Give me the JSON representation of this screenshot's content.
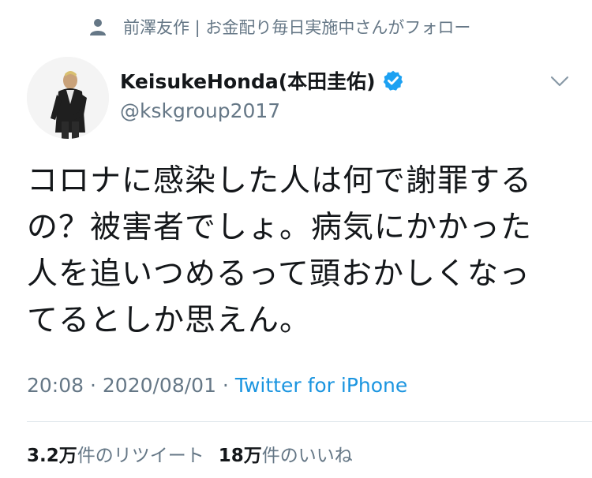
{
  "social_context": {
    "icon": "person-icon",
    "text": "前澤友作 | お金配り毎日実施中さんがフォロー"
  },
  "author": {
    "display_name": "KeisukeHonda(本田圭佑)",
    "handle": "@kskgroup2017",
    "verified": true
  },
  "tweet": {
    "lines": [
      "コロナに感染した人は何で謝罪する",
      "の？被害者でしょ。病気にかかった",
      "人を追いつめるって頭おかしくなっ",
      "てるとしか思えん。"
    ]
  },
  "meta": {
    "time": "20:08",
    "separator1": " · ",
    "date": "2020/08/01",
    "separator2": " · ",
    "source": "Twitter for iPhone"
  },
  "stats": {
    "retweets_num": "3.2万",
    "retweets_label": "件のリツイート",
    "likes_num": "18万",
    "likes_label": "件のいいね"
  },
  "colors": {
    "text": "#14171a",
    "muted": "#657786",
    "link": "#1b95e0",
    "verified": "#1da1f2"
  }
}
